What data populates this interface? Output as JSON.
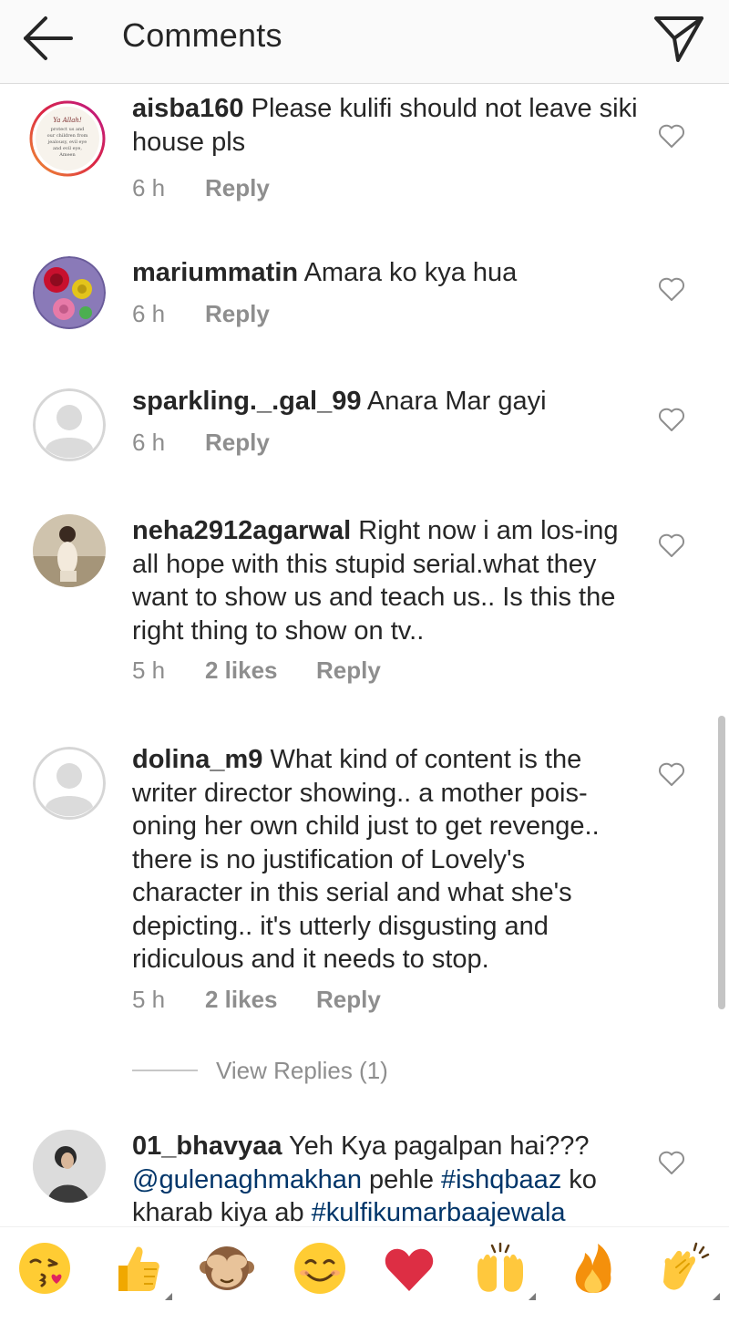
{
  "header": {
    "title": "Comments"
  },
  "comments": [
    {
      "username": "aisba160",
      "text": " Please kulifi should not leave siki house pls",
      "time": "6 h",
      "likes": "",
      "reply": "Reply",
      "avatar_text": [
        "Ya Allah!",
        "protect us and",
        "our children from",
        "jealousy, evil eye",
        "and evil eye,",
        "Ameen"
      ]
    },
    {
      "username": "mariummatin",
      "text": " Amara ko kya hua",
      "time": "6 h",
      "likes": "",
      "reply": "Reply"
    },
    {
      "username": "sparkling._.gal_99",
      "text": " Anara Mar gayi",
      "time": "6 h",
      "likes": "",
      "reply": "Reply"
    },
    {
      "username": "neha2912agarwal",
      "text": " Right now i am los-ing all hope with this stupid serial.what they want to show us and teach us.. Is this the right thing to show on tv..",
      "time": "5 h",
      "likes": "2 likes",
      "reply": "Reply"
    },
    {
      "username": "dolina_m9",
      "text": " What kind of content is the writer director showing.. a mother pois-oning her own child just to get revenge.. there is no justification of Lovely's character in this serial and what she's depicting.. it's utterly disgusting and ridiculous and it needs to stop.",
      "time": "5 h",
      "likes": "2 likes",
      "reply": "Reply",
      "view_replies": "View Replies (1)"
    },
    {
      "username": "01_bhavyaa",
      "text_before": " Yeh Kya pagalpan hai??? ",
      "mention": "@gulenaghmakhan",
      "text_mid": " pehle ",
      "hashtag1": "#ishqbaaz",
      "text_mid2": " ko kharab kiya ab ",
      "hashtag2": "#kulfikumarbaajewala"
    }
  ],
  "emoji_bar": [
    "kissing-face",
    "thumbs-up",
    "see-no-evil-monkey",
    "smiling-face",
    "red-heart",
    "raising-hands",
    "fire",
    "clapping-hands"
  ],
  "colors": {
    "header_bg": "#fafafa",
    "text": "#262626",
    "meta": "#8e8e8e",
    "link": "#003569"
  }
}
